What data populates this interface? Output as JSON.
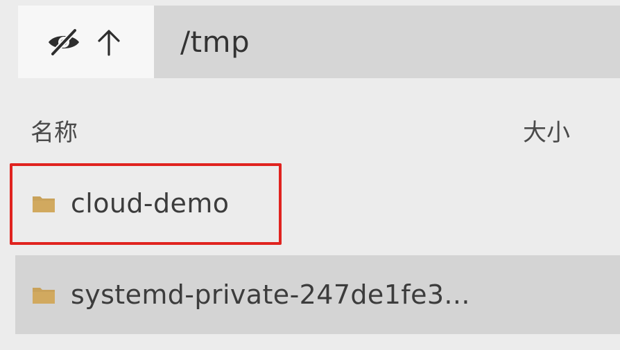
{
  "toolbar": {
    "hide_icon": "eye-slash-icon",
    "up_icon": "arrow-up-icon",
    "path": "/tmp"
  },
  "columns": {
    "name": "名称",
    "size": "大小"
  },
  "files": [
    {
      "name": "cloud-demo",
      "icon": "folder-icon",
      "highlighted": true
    },
    {
      "name": "systemd-private-247de1fe3...",
      "icon": "folder-icon",
      "selected": true
    }
  ],
  "colors": {
    "background": "#ececec",
    "path_bar": "#d6d6d6",
    "selected_row": "#d4d4d4",
    "folder": "#c9a25a",
    "highlight": "#e0231f"
  }
}
